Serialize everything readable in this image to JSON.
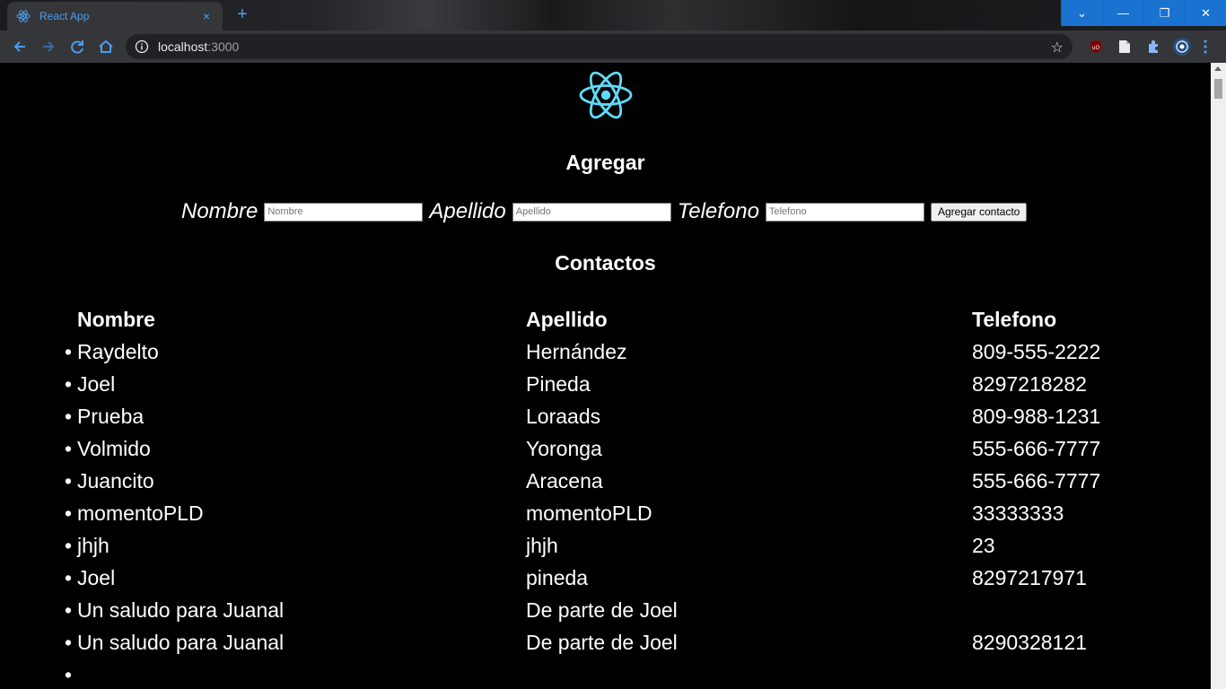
{
  "browser": {
    "tab_title": "React App",
    "tab_close": "×",
    "new_tab": "+",
    "url_host": "localhost",
    "url_port": ":3000",
    "star": "☆",
    "window_controls": {
      "tabsearch": "⌄",
      "minimize": "—",
      "restore": "❐",
      "close": "✕"
    },
    "accent_color": "#4d9ce8",
    "window_button_color": "#1a73d1"
  },
  "page": {
    "add_heading": "Agregar",
    "contacts_heading": "Contactos",
    "form": {
      "nombre_label": "Nombre",
      "nombre_placeholder": "Nombre",
      "apellido_label": "Apellido",
      "apellido_placeholder": "Apellido",
      "telefono_label": "Telefono",
      "telefono_placeholder": "Telefono",
      "submit_label": "Agregar contacto"
    },
    "table": {
      "headers": [
        "Nombre",
        "Apellido",
        "Telefono"
      ],
      "bullet": "•",
      "rows": [
        [
          "Raydelto",
          "Hernández",
          "809-555-2222"
        ],
        [
          "Joel",
          "Pineda",
          "8297218282"
        ],
        [
          "Prueba",
          "Loraads",
          "809-988-1231"
        ],
        [
          "Volmido",
          "Yoronga",
          "555-666-7777"
        ],
        [
          "Juancito",
          "Aracena",
          "555-666-7777"
        ],
        [
          "momentoPLD",
          "momentoPLD",
          "33333333"
        ],
        [
          "jhjh",
          "jhjh",
          "23"
        ],
        [
          "Joel",
          "pineda",
          "8297217971"
        ],
        [
          "Un saludo para Juanal",
          "De parte de Joel",
          ""
        ],
        [
          "Un saludo para Juanal",
          "De parte de Joel",
          "8290328121"
        ],
        [
          "",
          "",
          ""
        ]
      ]
    },
    "react_logo_color": "#61dafb"
  }
}
